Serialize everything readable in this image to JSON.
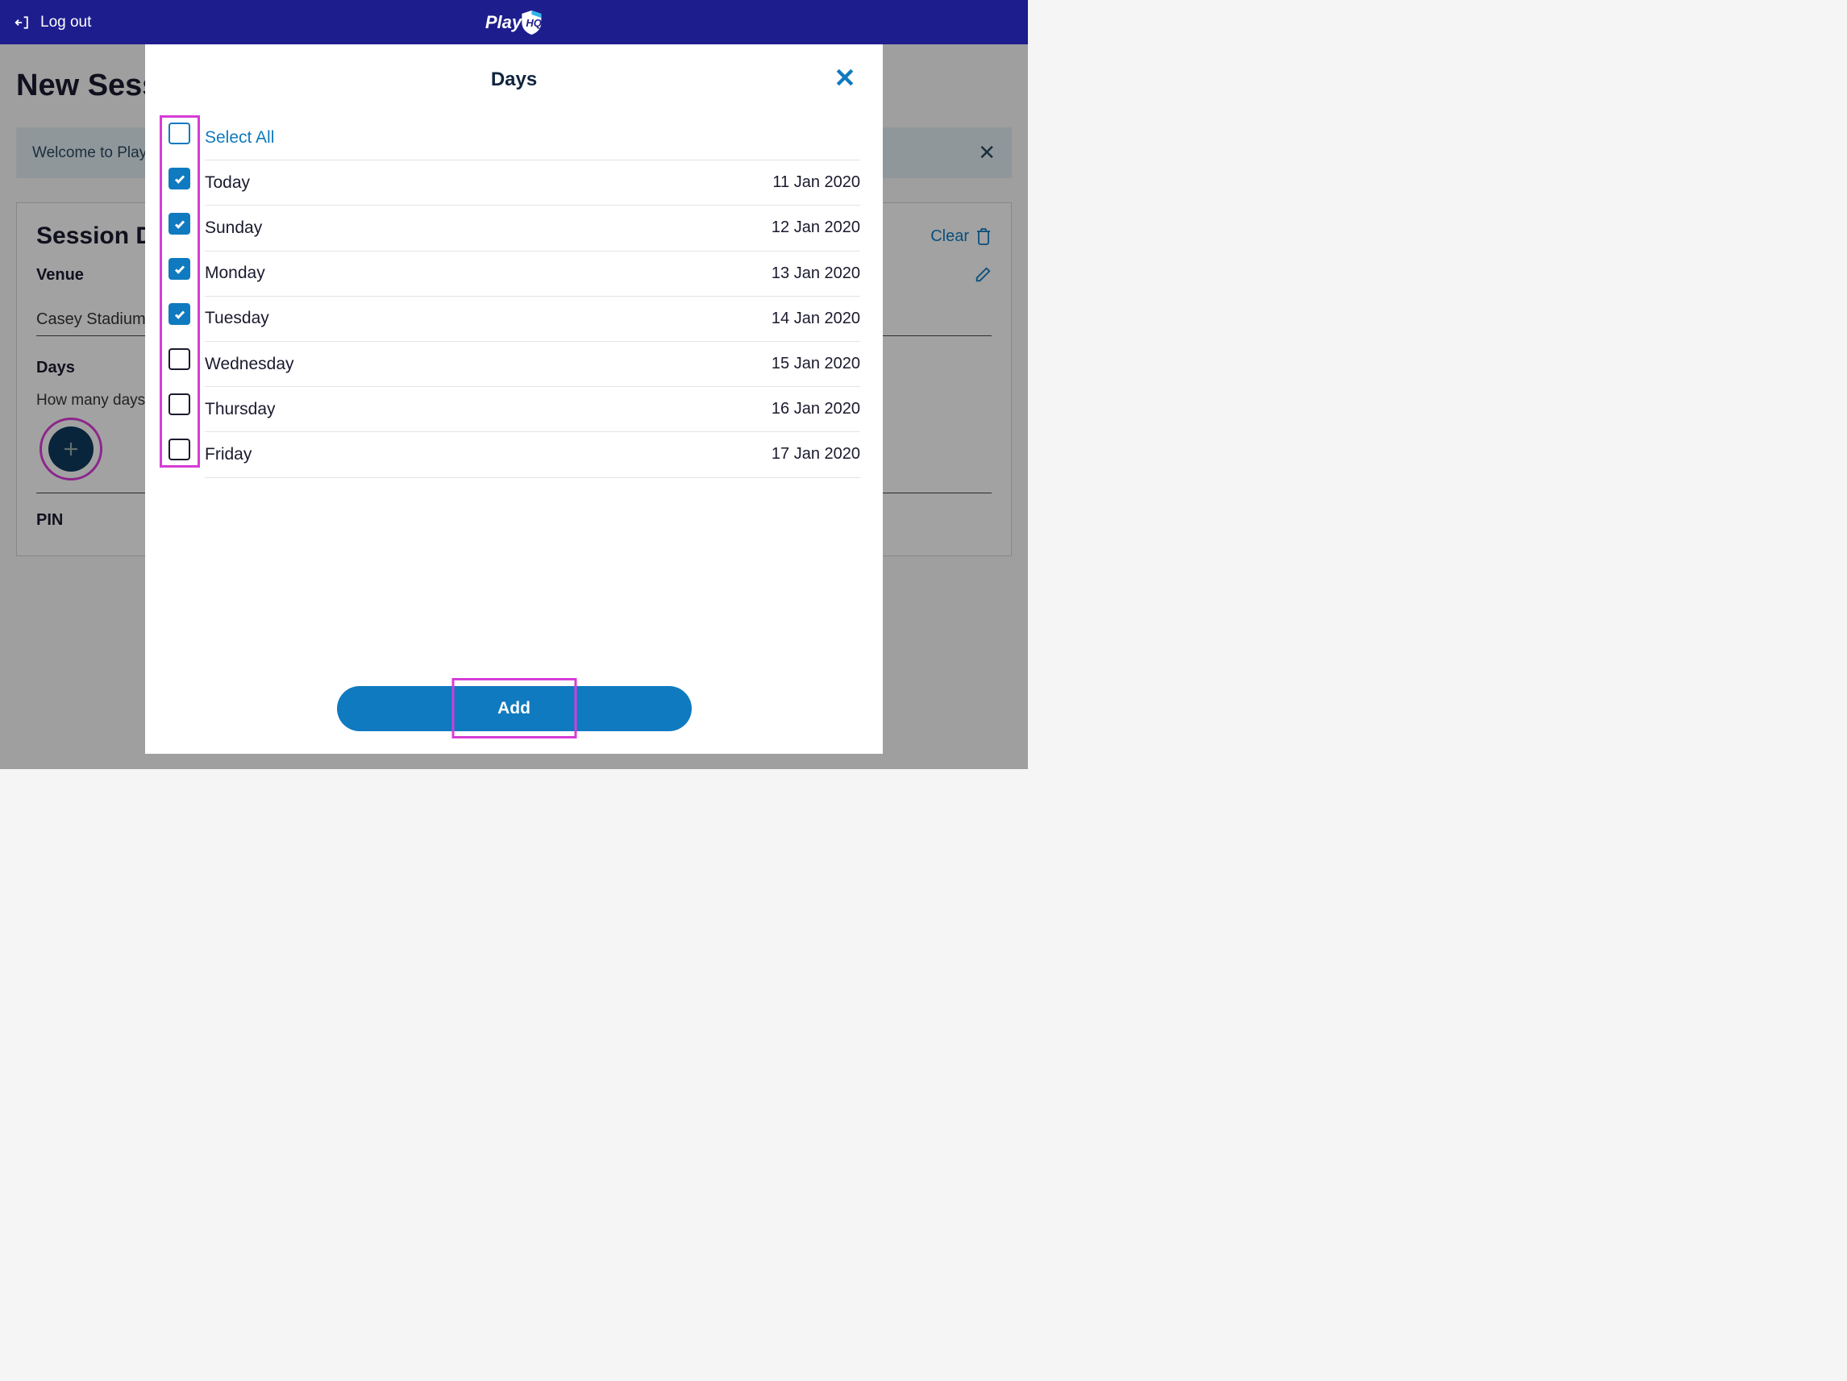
{
  "header": {
    "logout_label": "Log out",
    "logo_text": "Play"
  },
  "page": {
    "title": "New Session",
    "welcome_text": "Welcome to PlayHQ",
    "card_title": "Session Details",
    "clear_label": "Clear",
    "venue_label": "Venue",
    "venue_value": "Casey Stadium",
    "days_label": "Days",
    "days_help": "How many days",
    "pin_label": "PIN"
  },
  "modal": {
    "title": "Days",
    "select_all_label": "Select All",
    "add_button": "Add",
    "days": [
      {
        "label": "Today",
        "date": "11 Jan 2020",
        "checked": true
      },
      {
        "label": "Sunday",
        "date": "12 Jan 2020",
        "checked": true
      },
      {
        "label": "Monday",
        "date": "13 Jan 2020",
        "checked": true
      },
      {
        "label": "Tuesday",
        "date": "14 Jan 2020",
        "checked": true
      },
      {
        "label": "Wednesday",
        "date": "15 Jan 2020",
        "checked": false
      },
      {
        "label": "Thursday",
        "date": "16 Jan 2020",
        "checked": false
      },
      {
        "label": "Friday",
        "date": "17 Jan 2020",
        "checked": false
      }
    ]
  }
}
